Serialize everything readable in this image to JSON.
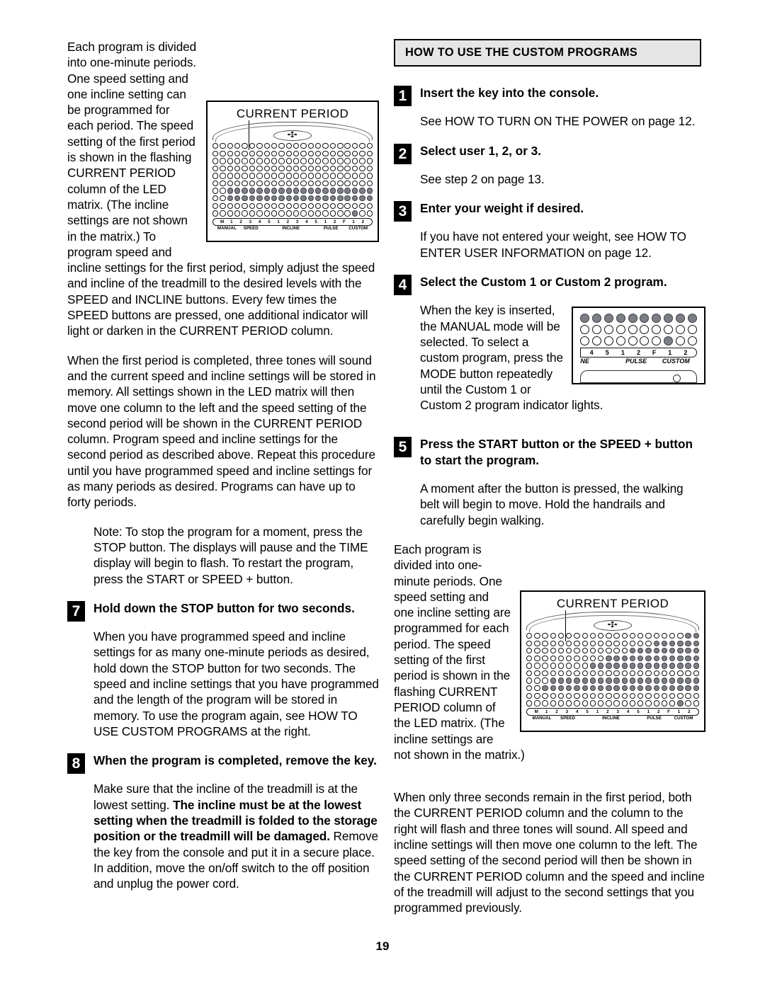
{
  "page": {
    "number": "19"
  },
  "left_column": {
    "paragraphs": [
      "Each program is divided into one-minute periods. One speed setting and one incline setting can be programmed for each period. The speed setting of the first period is shown in the flashing CURRENT PERIOD column of the LED matrix. (The incline settings are not shown in the matrix.) To program speed and incline settings for the first period, simply adjust the speed and incline of the treadmill to the desired levels with the SPEED and INCLINE buttons. Every few times the SPEED buttons are pressed, one additional indicator will light or darken in the CURRENT PERIOD column.",
      "When the first period is completed, three tones will sound and the current speed and incline settings will be stored in memory. All settings shown in the LED matrix will then move one column to the left and the speed setting of the second period will be shown in the CURRENT PERIOD column. Program speed and incline settings for the second period as described above. Repeat this procedure until you have programmed speed and incline settings for as many periods as desired. Programs can have up to forty periods.",
      "Note: To stop the program for a moment, press the STOP button. The displays will pause and the TIME display will begin to flash. To restart the program, press the START or SPEED + button."
    ],
    "steps": [
      {
        "number": "7",
        "title": "Hold down the STOP button for two seconds.",
        "body": "When you have programmed speed and incline settings for as many one-minute periods as desired, hold down the STOP button for two seconds. The speed and incline settings that you have programmed and the length of the program will be stored in memory. To use the program again, see HOW TO USE CUSTOM PROGRAMS at the right."
      },
      {
        "number": "8",
        "title": "When the program is completed, remove the key.",
        "body_lead": "Make sure that the incline of the treadmill is at the lowest setting. ",
        "body_bold": "The incline must be at the lowest setting when the treadmill is folded to the storage position or the treadmill will be damaged. ",
        "body_tail": "Remove the key from the console and put it in a secure place. In addition, move the on/off switch to the off position and unplug the power cord."
      }
    ]
  },
  "right_column": {
    "section_title": "HOW TO USE THE CUSTOM PROGRAMS",
    "steps": [
      {
        "number": "1",
        "title": "Insert the key into the console.",
        "body": "See HOW TO TURN ON THE POWER on page 12."
      },
      {
        "number": "2",
        "title": "Select user 1, 2, or 3.",
        "body": "See step 2 on page 13."
      },
      {
        "number": "3",
        "title": "Enter your weight if desired.",
        "body": "If you have not entered your weight, see HOW TO ENTER USER INFORMATION on page 12."
      },
      {
        "number": "4",
        "title": "Select the Custom 1 or Custom 2 program.",
        "body": "When the key is inserted, the MANUAL mode will be selected. To select a custom program, press the MODE button repeatedly until the Custom 1 or Custom 2 program indicator lights."
      },
      {
        "number": "5",
        "title": "Press the START button or the SPEED + button to start the program.",
        "body": "A moment after the button is pressed, the walking belt will begin to move. Hold the handrails and carefully begin walking."
      }
    ],
    "paragraphs": [
      "Each program is divided into one-minute periods. One speed setting and one incline setting are programmed for each period. The speed setting of the first period is shown in the flashing CURRENT PERIOD column of the LED matrix. (The incline settings are not shown in the matrix.)",
      "When only three seconds remain in the first period, both the CURRENT PERIOD column and the column to the right will flash and three tones will sound. All speed and incline settings will then move one column to the left. The speed setting of the second period will then be shown in the CURRENT PERIOD column and the speed and incline of the treadmill will adjust to the second settings that you programmed previously."
    ]
  },
  "console_diagram_1": {
    "caption": "CURRENT PERIOD",
    "logo": "brand-logo",
    "columns": 22,
    "rows": 10,
    "scale_numbers": [
      "M",
      "1",
      "2",
      "3",
      "4",
      "5",
      "1",
      "2",
      "3",
      "4",
      "5",
      "1",
      "2",
      "F",
      "1",
      "2"
    ],
    "group_labels": [
      "MANUAL",
      "SPEED",
      "INCLINE",
      "PULSE",
      "CUSTOM"
    ],
    "lit_rows": [
      6,
      7
    ],
    "lit_extra": "custom-1-indicator"
  },
  "console_diagram_2": {
    "caption": "CURRENT PERIOD",
    "logo": "brand-logo",
    "columns": 22,
    "rows": 10,
    "scale_numbers": [
      "M",
      "1",
      "2",
      "3",
      "4",
      "5",
      "1",
      "2",
      "3",
      "4",
      "5",
      "1",
      "2",
      "F",
      "1",
      "2"
    ],
    "group_labels": [
      "MANUAL",
      "SPEED",
      "INCLINE",
      "PULSE",
      "CUSTOM"
    ],
    "pattern": "ascending-ramp",
    "lit_extra": "custom-1-indicator"
  },
  "console_closeup": {
    "scale_numbers": [
      "4",
      "5",
      "1",
      "2",
      "F",
      "1",
      "2"
    ],
    "group_labels": [
      "NE",
      "PULSE",
      "CUSTOM"
    ],
    "lit": "custom-1-indicator"
  },
  "colors": {
    "led_on": "#7d7f86",
    "led_off": "#ffffff",
    "header_bg": "#e6e6e6",
    "ink": "#000000"
  }
}
